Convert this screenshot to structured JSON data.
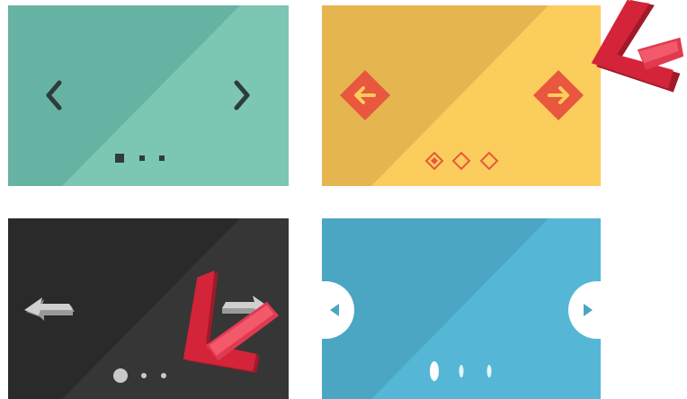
{
  "panels": [
    {
      "id": "teal",
      "colors": {
        "dark": "#67b3a3",
        "light": "#7cc6b4",
        "control": "#2e3c3a"
      },
      "prev_icon": "chevron-left-icon",
      "next_icon": "chevron-right-icon",
      "indicators": {
        "style": "squares",
        "count": 3,
        "active_index": 0
      }
    },
    {
      "id": "yellow",
      "colors": {
        "dark": "#e5b64f",
        "light": "#fbcd5c",
        "control": "#e8573e"
      },
      "prev_icon": "diamond-arrow-left-icon",
      "next_icon": "diamond-arrow-right-icon",
      "indicators": {
        "style": "diamonds",
        "count": 3,
        "active_index": 0
      }
    },
    {
      "id": "dark",
      "colors": {
        "dark": "#2a2a2a",
        "light": "#363636",
        "control": "#c9c9c9"
      },
      "prev_icon": "arrow-left-icon",
      "next_icon": "arrow-right-icon",
      "indicators": {
        "style": "dots",
        "count": 3,
        "active_index": 0
      }
    },
    {
      "id": "blue",
      "colors": {
        "dark": "#4aa6c3",
        "light": "#56b6d6",
        "control": "#ffffff"
      },
      "prev_icon": "half-circle-prev-icon",
      "next_icon": "half-circle-next-icon",
      "indicators": {
        "style": "pills",
        "count": 3,
        "active_index": 0
      }
    }
  ],
  "pointer_color": "#d4243a",
  "pointer_highlight": "#f25a6b",
  "pointer_icon": "red-pointer-arrow-icon"
}
